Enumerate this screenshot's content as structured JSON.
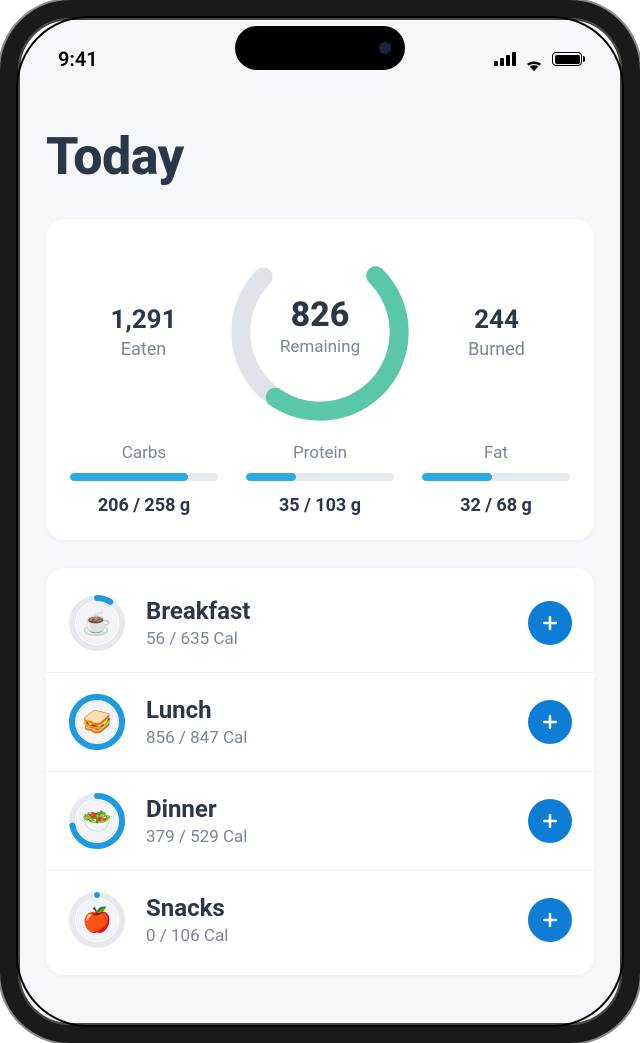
{
  "status": {
    "time": "9:41"
  },
  "title": "Today",
  "summary": {
    "eaten": {
      "value": "1,291",
      "label": "Eaten"
    },
    "remaining": {
      "value": "826",
      "label": "Remaining",
      "percent": 63
    },
    "burned": {
      "value": "244",
      "label": "Burned"
    }
  },
  "macros": [
    {
      "name": "Carbs",
      "value": "206 / 258 g",
      "percent": 80
    },
    {
      "name": "Protein",
      "value": "35 / 103 g",
      "percent": 34
    },
    {
      "name": "Fat",
      "value": "32 / 68 g",
      "percent": 47
    }
  ],
  "meals": [
    {
      "name": "Breakfast",
      "cals": "56 / 635 Cal",
      "percent": 9,
      "icon": "☕"
    },
    {
      "name": "Lunch",
      "cals": "856 / 847 Cal",
      "percent": 100,
      "icon": "🥪"
    },
    {
      "name": "Dinner",
      "cals": "379 / 529 Cal",
      "percent": 72,
      "icon": "🥗"
    },
    {
      "name": "Snacks",
      "cals": "0 / 106 Cal",
      "percent": 0,
      "icon": "🍎"
    }
  ],
  "colors": {
    "ring": "#5ac7a9",
    "ring_bg": "#e0e4ea",
    "meal_ring": "#1d9ae0",
    "meal_ring_bg": "#e6eaef"
  }
}
